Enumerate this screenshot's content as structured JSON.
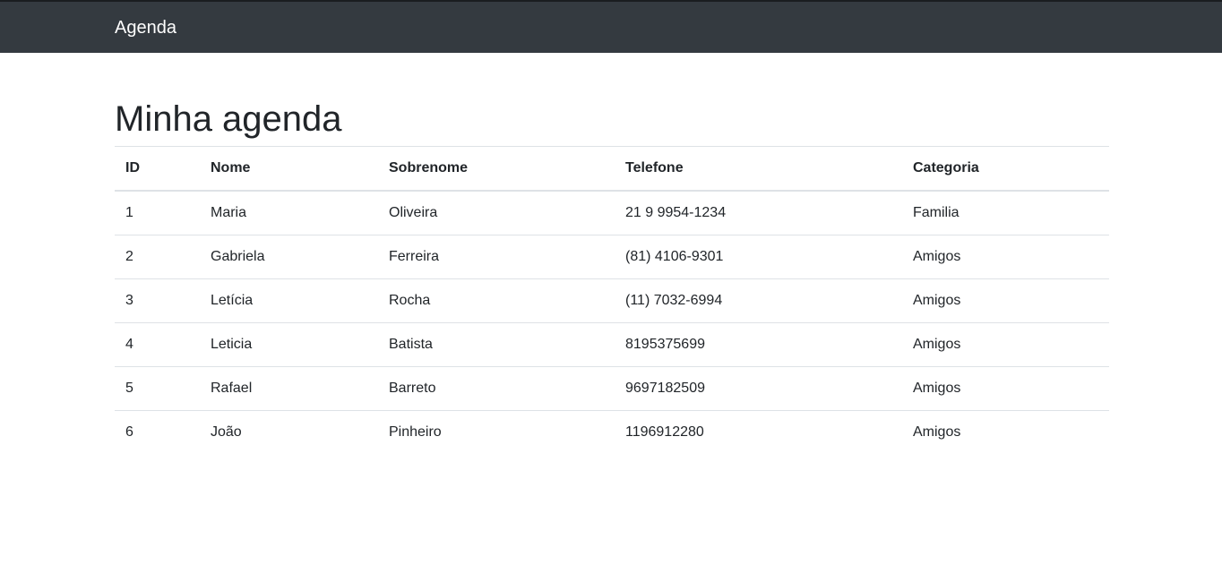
{
  "navbar": {
    "brand": "Agenda"
  },
  "page": {
    "title": "Minha agenda"
  },
  "table": {
    "headers": [
      "ID",
      "Nome",
      "Sobrenome",
      "Telefone",
      "Categoria"
    ],
    "rows": [
      [
        "1",
        "Maria",
        "Oliveira",
        "21 9 9954-1234",
        "Familia"
      ],
      [
        "2",
        "Gabriela",
        "Ferreira",
        "(81) 4106-9301",
        "Amigos"
      ],
      [
        "3",
        "Letícia",
        "Rocha",
        "(11) 7032-6994",
        "Amigos"
      ],
      [
        "4",
        "Leticia",
        "Batista",
        "8195375699",
        "Amigos"
      ],
      [
        "5",
        "Rafael",
        "Barreto",
        "9697182509",
        "Amigos"
      ],
      [
        "6",
        "João",
        "Pinheiro",
        "1196912280",
        "Amigos"
      ]
    ]
  }
}
